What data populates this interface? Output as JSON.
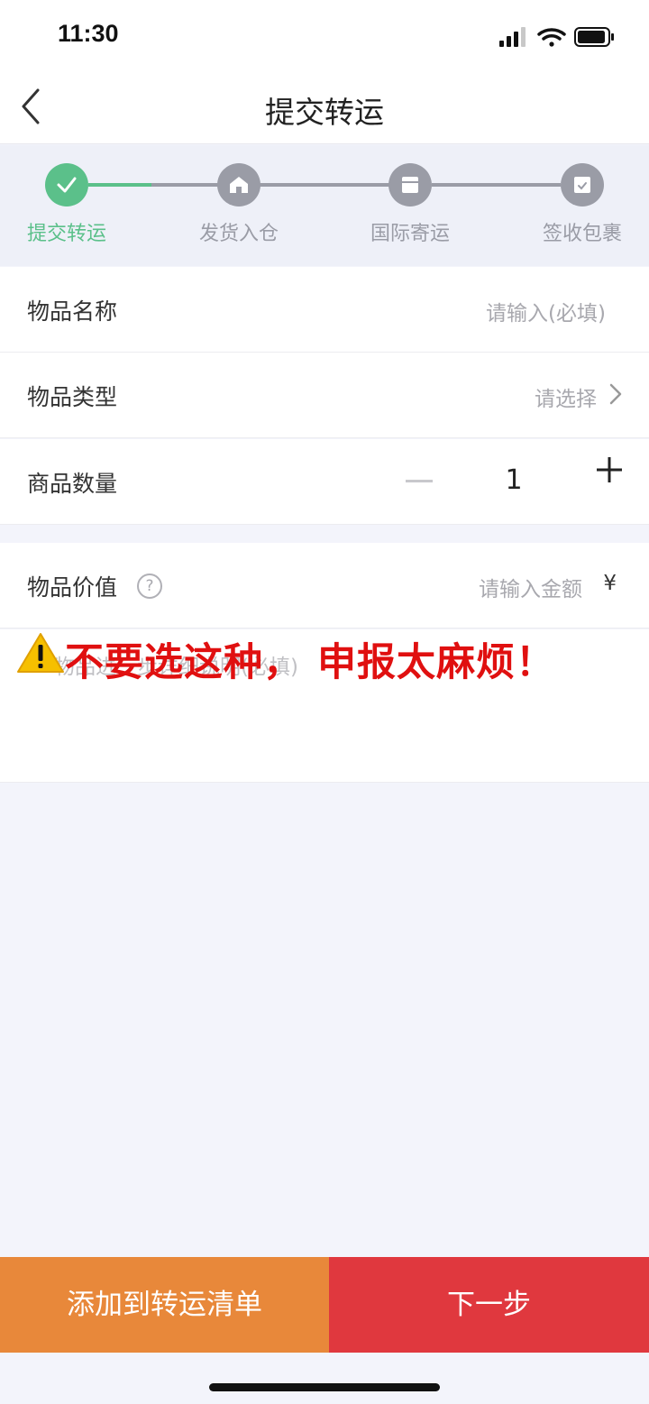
{
  "status_bar": {
    "time": "11:30"
  },
  "nav": {
    "title": "提交转运"
  },
  "steps": [
    {
      "label": "提交转运",
      "icon": "check-icon",
      "state": "done"
    },
    {
      "label": "发货入仓",
      "icon": "warehouse-icon",
      "state": "pending"
    },
    {
      "label": "国际寄运",
      "icon": "shipping-box-icon",
      "state": "pending"
    },
    {
      "label": "签收包裹",
      "icon": "package-received-icon",
      "state": "pending"
    }
  ],
  "form": {
    "item_name": {
      "label": "物品名称",
      "placeholder": "请输入(必填)"
    },
    "item_type": {
      "label": "物品类型",
      "placeholder": "请选择"
    },
    "quantity": {
      "label": "商品数量",
      "value": "1"
    },
    "item_value": {
      "label": "物品价值",
      "placeholder": "请输入金额",
      "currency": "¥",
      "help": "?"
    },
    "description": {
      "placeholder": "物品进一步详细说明(必填)"
    }
  },
  "warning": {
    "text": "不要选这种， 申报太麻烦！"
  },
  "buttons": {
    "add_to_list": "添加到转运清单",
    "next": "下一步"
  },
  "colors": {
    "accent_green": "#5bc08a",
    "step_gray": "#9a9ca6",
    "add_button": "#e8883a",
    "next_button": "#e0383e",
    "warning_red": "#e01010"
  }
}
